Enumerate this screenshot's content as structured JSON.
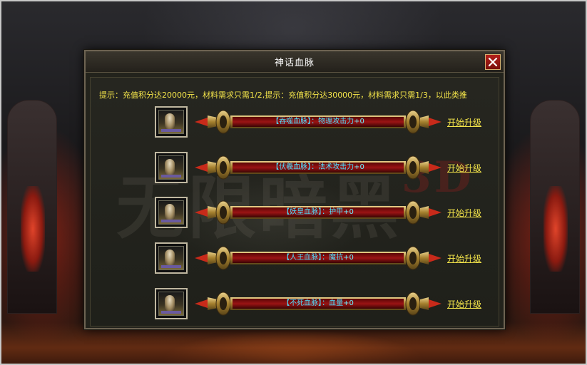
{
  "dialog": {
    "title": "神话血脉",
    "hint": "提示：充值积分达20000元，材料需求只需1/2,提示：充值积分达30000元，材料需求只需1/3，以此类推"
  },
  "rows": [
    {
      "name": "【吞噬血脉】",
      "sep": "：",
      "attr": "物理攻击力",
      "value": "+0",
      "action": "开始升级"
    },
    {
      "name": "【伏羲血脉】",
      "sep": "：",
      "attr": "法术攻击力",
      "value": "+0",
      "action": "开始升级"
    },
    {
      "name": "【妖皇血脉】",
      "sep": "：",
      "attr": "护甲",
      "value": "+0",
      "action": "开始升级"
    },
    {
      "name": "【人王血脉】",
      "sep": "：",
      "attr": "魔抗",
      "value": "+0",
      "action": "开始升级"
    },
    {
      "name": "【不死血脉】",
      "sep": "：",
      "attr": "血量",
      "value": "+0",
      "action": "开始升级"
    }
  ],
  "colors": {
    "hint": "#f3e44a",
    "bar_text": "#4ee0ff",
    "bar_fill": "#8a1010",
    "gold": "#c9a24a",
    "close_red": "#b3201a"
  },
  "icons": {
    "close": "close-x-icon",
    "bar_end": "spearhead-icon"
  }
}
